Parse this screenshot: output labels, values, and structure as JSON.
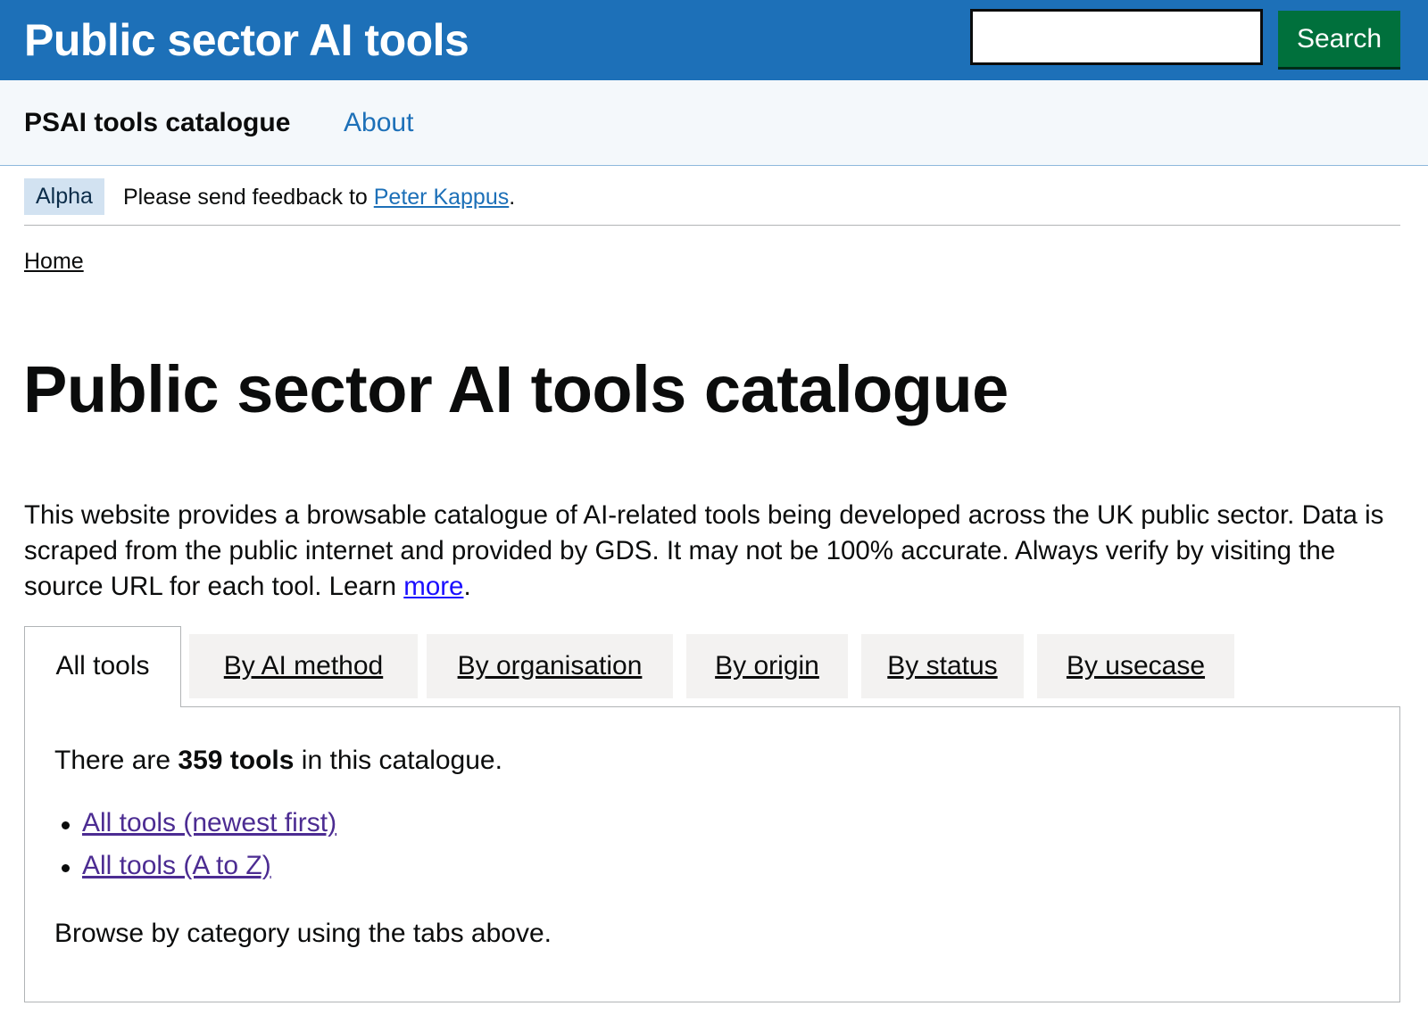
{
  "header": {
    "site_title": "Public sector AI tools",
    "search_value": "",
    "search_button": "Search"
  },
  "service_nav": {
    "service_name": "PSAI tools catalogue",
    "about": "About"
  },
  "phase_banner": {
    "tag": "Alpha",
    "text_before": "Please send feedback to ",
    "link": "Peter Kappus",
    "text_after": "."
  },
  "breadcrumb": {
    "home": "Home"
  },
  "main": {
    "title": "Public sector AI tools catalogue",
    "intro_text": "This website provides a browsable catalogue of AI-related tools being developed across the UK public sector. Data is scraped from the public internet and provided by GDS. It may not be 100% accurate. Always verify by visiting the source URL for each tool. Learn ",
    "intro_link": "more",
    "intro_end": "."
  },
  "tabs": [
    {
      "label": "All tools",
      "active": true
    },
    {
      "label": "By AI method",
      "active": false
    },
    {
      "label": "By organisation",
      "active": false
    },
    {
      "label": "By origin",
      "active": false
    },
    {
      "label": "By status",
      "active": false
    },
    {
      "label": "By usecase",
      "active": false
    }
  ],
  "panel": {
    "count_prefix": "There are ",
    "count_value": "359 tools",
    "count_suffix": " in this catalogue.",
    "links": [
      "All tools (newest first)",
      "All tools (A to Z)"
    ],
    "browse_text": "Browse by category using the tabs above."
  },
  "colors": {
    "header_bg": "#1d70b8",
    "search_button_bg": "#00703c",
    "link": "#1d70b8",
    "visited_link": "#4c2c92",
    "phase_tag_bg": "#d2e2f1"
  }
}
